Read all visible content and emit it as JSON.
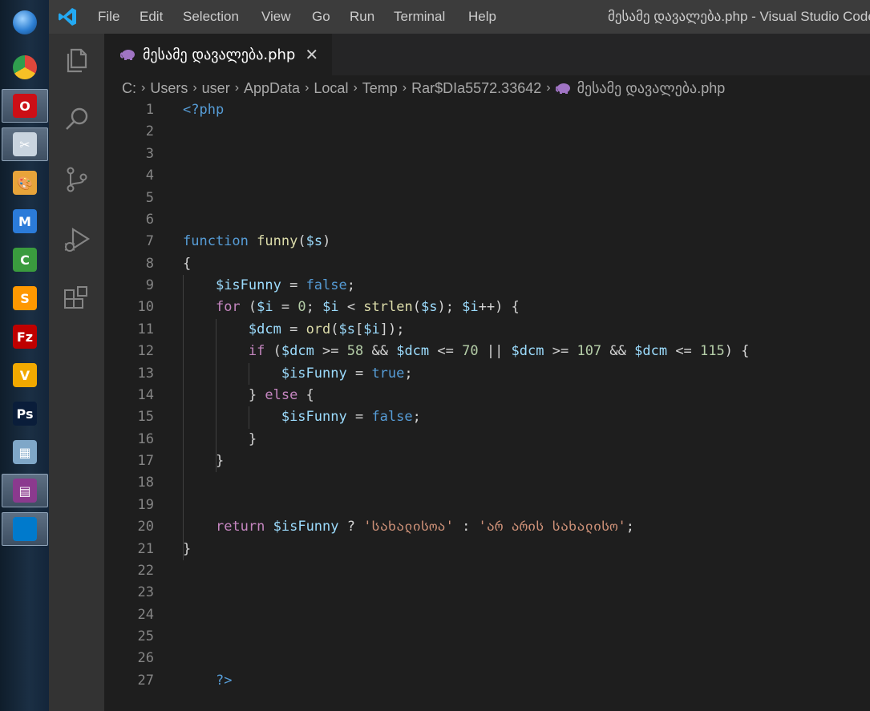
{
  "taskbar": {
    "items": [
      {
        "name": "start-orb",
        "label": "",
        "color": "#2d7fd3"
      },
      {
        "name": "chrome",
        "label": "",
        "color": "#e0473b"
      },
      {
        "name": "opera",
        "label": "O",
        "color": "#cc0f16"
      },
      {
        "name": "snipping-tool",
        "label": "✂",
        "color": "#c9d4df"
      },
      {
        "name": "paint",
        "label": "🎨",
        "color": "#e8a43a"
      },
      {
        "name": "kinemaster",
        "label": "M",
        "color": "#2b7bd9"
      },
      {
        "name": "camtasia",
        "label": "C",
        "color": "#3a9b3e"
      },
      {
        "name": "sublime",
        "label": "S",
        "color": "#ff9800"
      },
      {
        "name": "filezilla",
        "label": "Fz",
        "color": "#bf0000"
      },
      {
        "name": "vectorian",
        "label": "V",
        "color": "#f2a900"
      },
      {
        "name": "photoshop",
        "label": "Ps",
        "color": "#0a1d3a"
      },
      {
        "name": "calculator",
        "label": "▦",
        "color": "#7fa7c8"
      },
      {
        "name": "winrar",
        "label": "▤",
        "color": "#8b3a8e"
      },
      {
        "name": "vscode",
        "label": "",
        "color": "#007acc"
      }
    ]
  },
  "titlebar": {
    "menu": [
      "File",
      "Edit",
      "Selection",
      "View",
      "Go",
      "Run",
      "Terminal",
      "Help"
    ],
    "window_title": "მესამე დავალება.php - Visual Studio Code"
  },
  "tab": {
    "label": "მესამე დავალება.php",
    "close": "✕"
  },
  "breadcrumbs": [
    "C:",
    "Users",
    "user",
    "AppData",
    "Local",
    "Temp",
    "Rar$DIa5572.33642",
    "მესამე დავალება.php"
  ],
  "editor": {
    "line_numbers": [
      "1",
      "2",
      "3",
      "4",
      "5",
      "6",
      "7",
      "8",
      "9",
      "10",
      "11",
      "12",
      "13",
      "14",
      "15",
      "16",
      "17",
      "18",
      "19",
      "20",
      "21",
      "22",
      "23",
      "24",
      "25",
      "26",
      "27"
    ],
    "lines": [
      [
        {
          "t": "k",
          "v": "<?php"
        }
      ],
      [],
      [],
      [],
      [],
      [],
      [
        {
          "t": "k",
          "v": "function"
        },
        {
          "t": "p",
          "v": " "
        },
        {
          "t": "f",
          "v": "funny"
        },
        {
          "t": "p",
          "v": "("
        },
        {
          "t": "v",
          "v": "$s"
        },
        {
          "t": "p",
          "v": ")"
        }
      ],
      [
        {
          "t": "p",
          "v": "{"
        }
      ],
      [
        {
          "t": "p",
          "v": "    "
        },
        {
          "t": "v",
          "v": "$isFunny"
        },
        {
          "t": "p",
          "v": " = "
        },
        {
          "t": "k",
          "v": "false"
        },
        {
          "t": "p",
          "v": ";"
        }
      ],
      [
        {
          "t": "p",
          "v": "    "
        },
        {
          "t": "c",
          "v": "for"
        },
        {
          "t": "p",
          "v": " ("
        },
        {
          "t": "v",
          "v": "$i"
        },
        {
          "t": "p",
          "v": " = "
        },
        {
          "t": "n",
          "v": "0"
        },
        {
          "t": "p",
          "v": "; "
        },
        {
          "t": "v",
          "v": "$i"
        },
        {
          "t": "p",
          "v": " < "
        },
        {
          "t": "f",
          "v": "strlen"
        },
        {
          "t": "p",
          "v": "("
        },
        {
          "t": "v",
          "v": "$s"
        },
        {
          "t": "p",
          "v": "); "
        },
        {
          "t": "v",
          "v": "$i"
        },
        {
          "t": "p",
          "v": "++) {"
        }
      ],
      [
        {
          "t": "p",
          "v": "        "
        },
        {
          "t": "v",
          "v": "$dcm"
        },
        {
          "t": "p",
          "v": " = "
        },
        {
          "t": "f",
          "v": "ord"
        },
        {
          "t": "p",
          "v": "("
        },
        {
          "t": "v",
          "v": "$s"
        },
        {
          "t": "p",
          "v": "["
        },
        {
          "t": "v",
          "v": "$i"
        },
        {
          "t": "p",
          "v": "]);"
        }
      ],
      [
        {
          "t": "p",
          "v": "        "
        },
        {
          "t": "c",
          "v": "if"
        },
        {
          "t": "p",
          "v": " ("
        },
        {
          "t": "v",
          "v": "$dcm"
        },
        {
          "t": "p",
          "v": " >= "
        },
        {
          "t": "n",
          "v": "58"
        },
        {
          "t": "p",
          "v": " && "
        },
        {
          "t": "v",
          "v": "$dcm"
        },
        {
          "t": "p",
          "v": " <= "
        },
        {
          "t": "n",
          "v": "70"
        },
        {
          "t": "p",
          "v": " || "
        },
        {
          "t": "v",
          "v": "$dcm"
        },
        {
          "t": "p",
          "v": " >= "
        },
        {
          "t": "n",
          "v": "107"
        },
        {
          "t": "p",
          "v": " && "
        },
        {
          "t": "v",
          "v": "$dcm"
        },
        {
          "t": "p",
          "v": " <= "
        },
        {
          "t": "n",
          "v": "115"
        },
        {
          "t": "p",
          "v": ") {"
        }
      ],
      [
        {
          "t": "p",
          "v": "            "
        },
        {
          "t": "v",
          "v": "$isFunny"
        },
        {
          "t": "p",
          "v": " = "
        },
        {
          "t": "k",
          "v": "true"
        },
        {
          "t": "p",
          "v": ";"
        }
      ],
      [
        {
          "t": "p",
          "v": "        } "
        },
        {
          "t": "c",
          "v": "else"
        },
        {
          "t": "p",
          "v": " {"
        }
      ],
      [
        {
          "t": "p",
          "v": "            "
        },
        {
          "t": "v",
          "v": "$isFunny"
        },
        {
          "t": "p",
          "v": " = "
        },
        {
          "t": "k",
          "v": "false"
        },
        {
          "t": "p",
          "v": ";"
        }
      ],
      [
        {
          "t": "p",
          "v": "        }"
        }
      ],
      [
        {
          "t": "p",
          "v": "    }"
        }
      ],
      [],
      [],
      [
        {
          "t": "p",
          "v": "    "
        },
        {
          "t": "c",
          "v": "return"
        },
        {
          "t": "p",
          "v": " "
        },
        {
          "t": "v",
          "v": "$isFunny"
        },
        {
          "t": "p",
          "v": " ? "
        },
        {
          "t": "s",
          "v": "'სახალისოა'"
        },
        {
          "t": "p",
          "v": " : "
        },
        {
          "t": "s",
          "v": "'არ არის სახალისო'"
        },
        {
          "t": "p",
          "v": ";"
        }
      ],
      [
        {
          "t": "p",
          "v": "}"
        }
      ],
      [],
      [],
      [],
      [],
      [],
      [
        {
          "t": "p",
          "v": "    "
        },
        {
          "t": "k",
          "v": "?>"
        }
      ]
    ]
  },
  "colors": {
    "titlebar_bg": "#3c3c3c",
    "activitybar_bg": "#333333",
    "editor_bg": "#1e1e1e",
    "vscode_blue": "#23a9f2",
    "php_icon": "#a074c4"
  }
}
